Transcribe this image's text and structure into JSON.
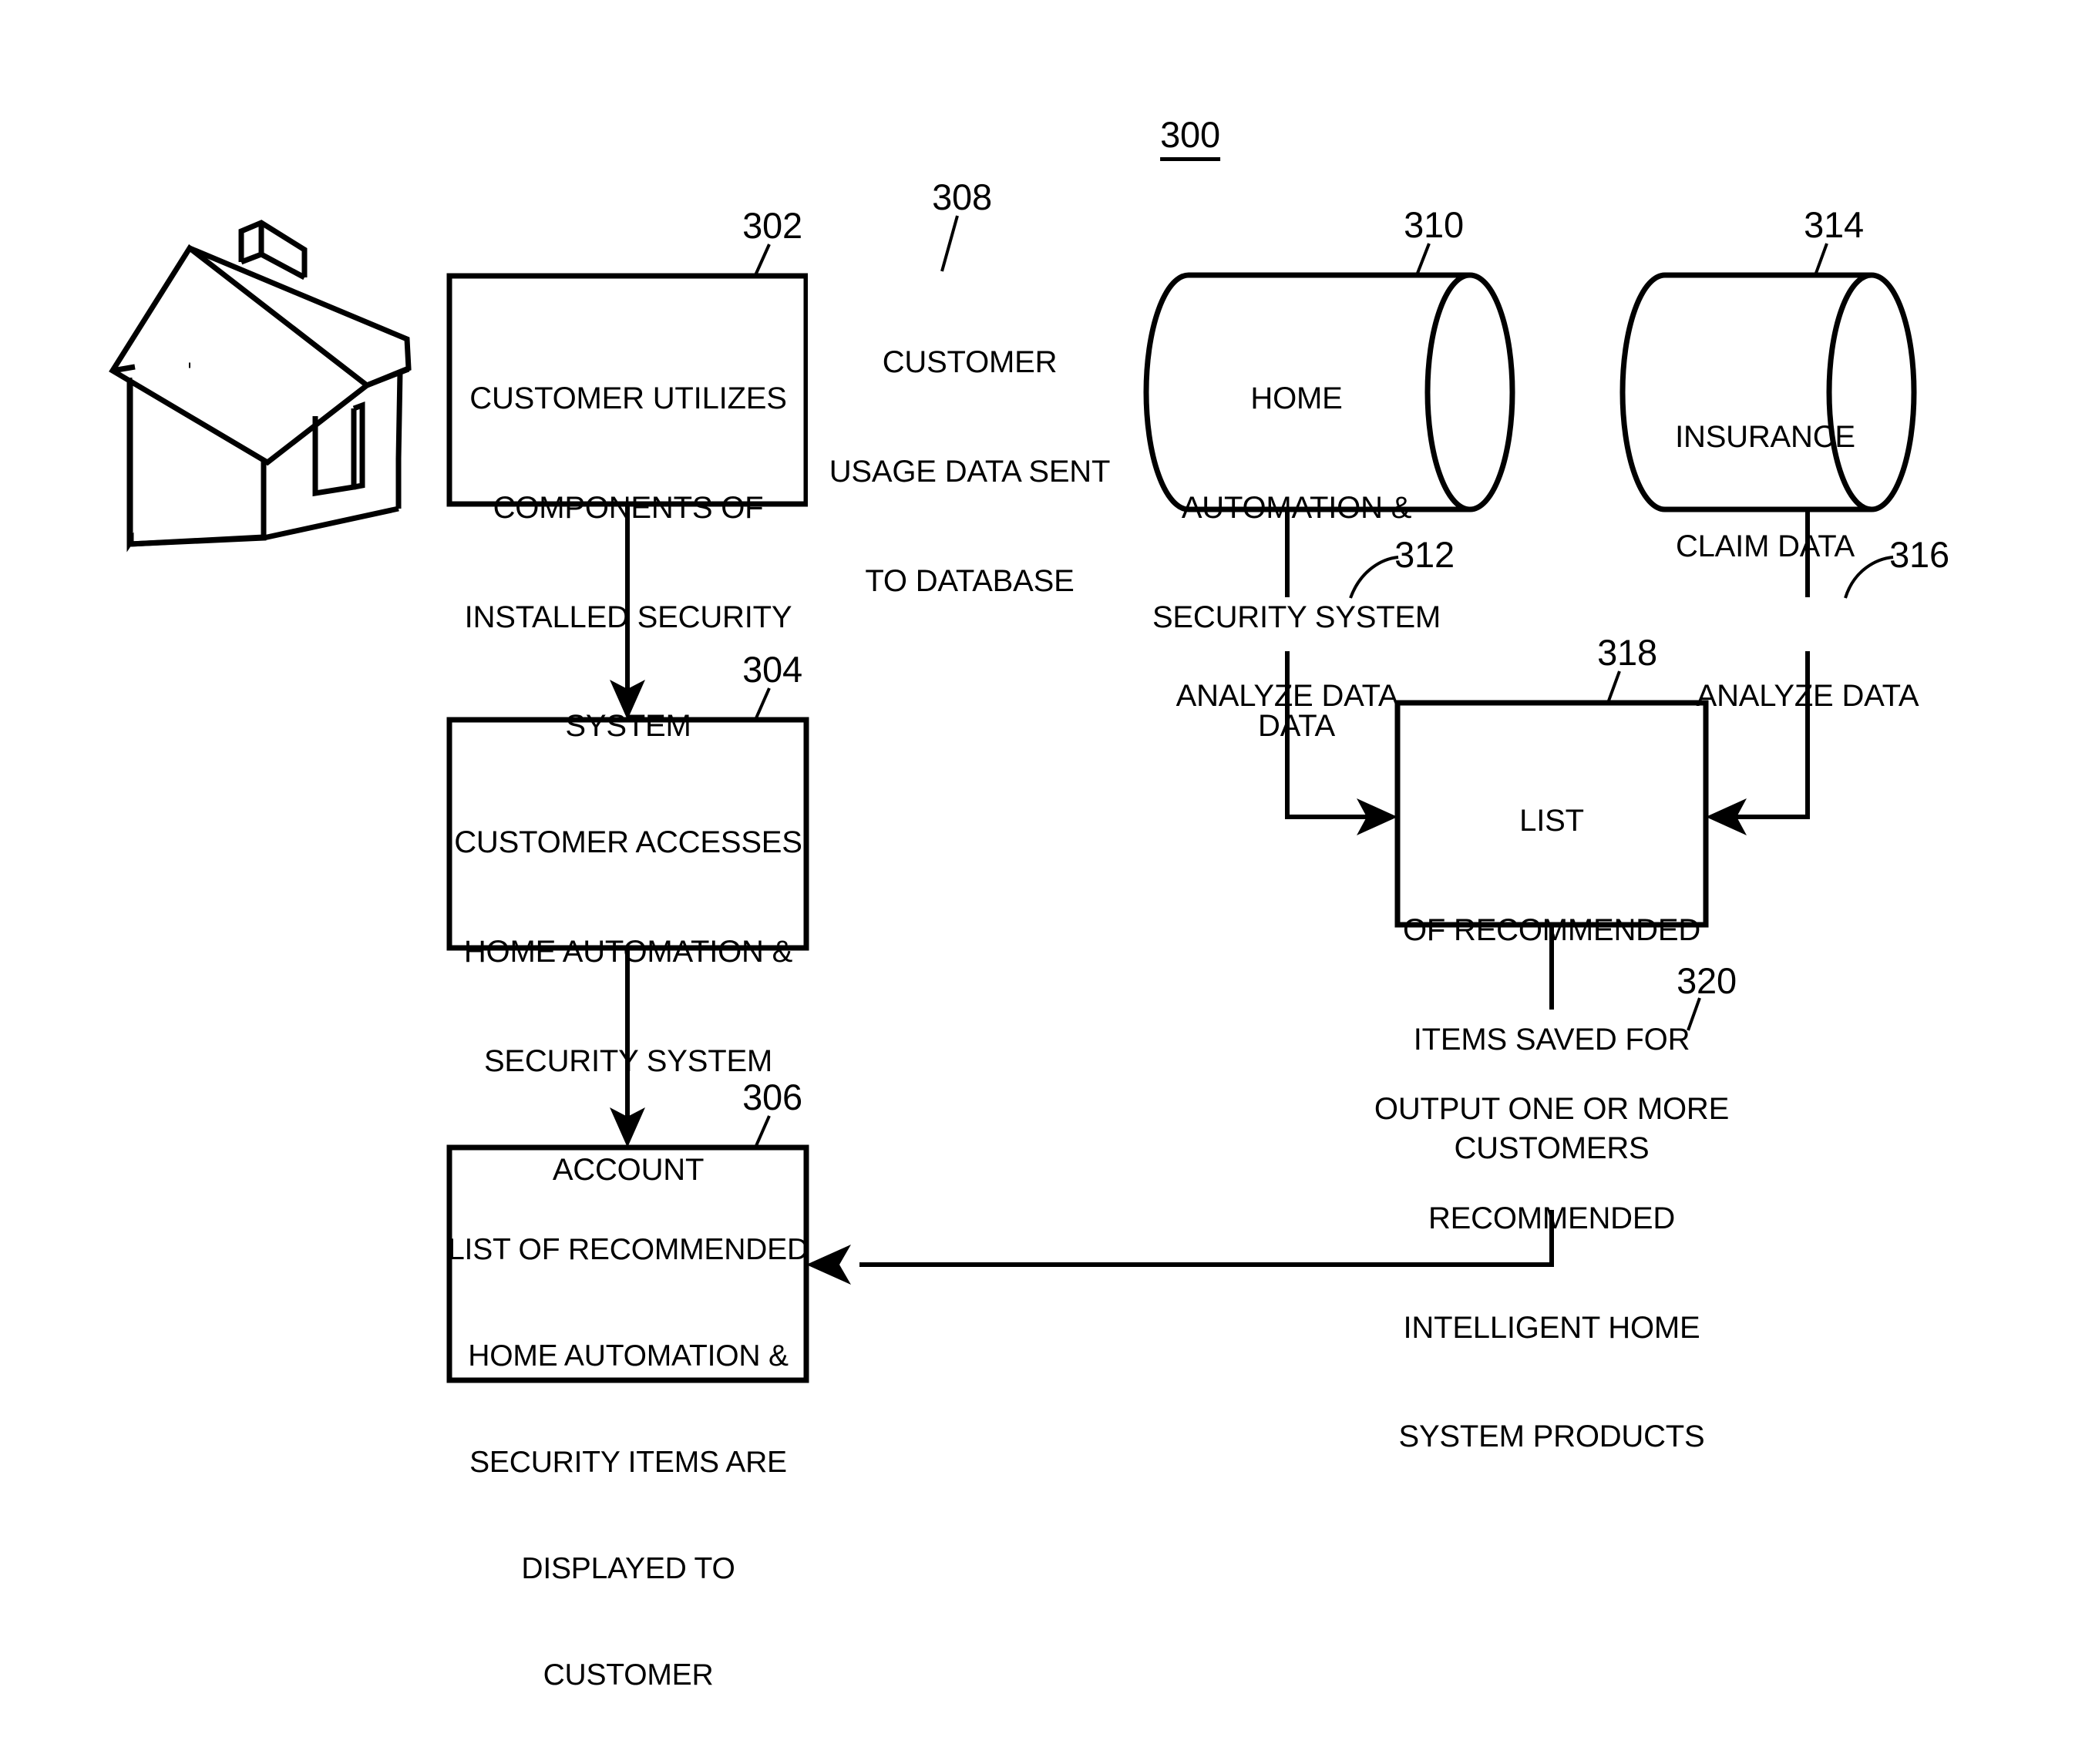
{
  "figure": {
    "number": "300",
    "type": "patent-flow-diagram"
  },
  "nodes": [
    {
      "id": "302",
      "ref": "302",
      "shape": "rectangle",
      "lines": [
        "CUSTOMER UTILIZES",
        "COMPONENTS OF",
        "INSTALLED SECURITY",
        "SYSTEM"
      ]
    },
    {
      "id": "304",
      "ref": "304",
      "shape": "rectangle",
      "lines": [
        "CUSTOMER ACCESSES",
        "HOME AUTOMATION &",
        "SECURITY SYSTEM",
        "ACCOUNT"
      ]
    },
    {
      "id": "306",
      "ref": "306",
      "shape": "rectangle",
      "lines": [
        "LIST OF RECOMMENDED",
        "HOME AUTOMATION &",
        "SECURITY ITEMS ARE",
        "DISPLAYED TO",
        "CUSTOMER"
      ]
    },
    {
      "id": "310",
      "ref": "310",
      "shape": "cylinder",
      "lines": [
        "HOME",
        "AUTOMATION &",
        "SECURITY SYSTEM",
        "DATA"
      ]
    },
    {
      "id": "314",
      "ref": "314",
      "shape": "cylinder",
      "lines": [
        "INSURANCE",
        "CLAIM DATA"
      ]
    },
    {
      "id": "318",
      "ref": "318",
      "shape": "rectangle",
      "lines": [
        "LIST",
        "OF RECOMMENDED",
        "ITEMS SAVED FOR",
        "CUSTOMERS"
      ]
    }
  ],
  "edge_labels": [
    {
      "id": "308",
      "ref": "308",
      "lines": [
        "CUSTOMER",
        "USAGE DATA SENT",
        "TO DATABASE"
      ]
    },
    {
      "id": "312",
      "ref": "312",
      "lines": [
        "ANALYZE DATA"
      ]
    },
    {
      "id": "316",
      "ref": "316",
      "lines": [
        "ANALYZE DATA"
      ]
    },
    {
      "id": "320",
      "ref": "320",
      "lines": [
        "OUTPUT ONE OR MORE",
        "RECOMMENDED",
        "INTELLIGENT HOME",
        "SYSTEM PRODUCTS"
      ]
    }
  ],
  "illustration": {
    "house": "isometric-house-line-drawing"
  },
  "colors": {
    "ink": "#000000",
    "paper": "#ffffff"
  }
}
